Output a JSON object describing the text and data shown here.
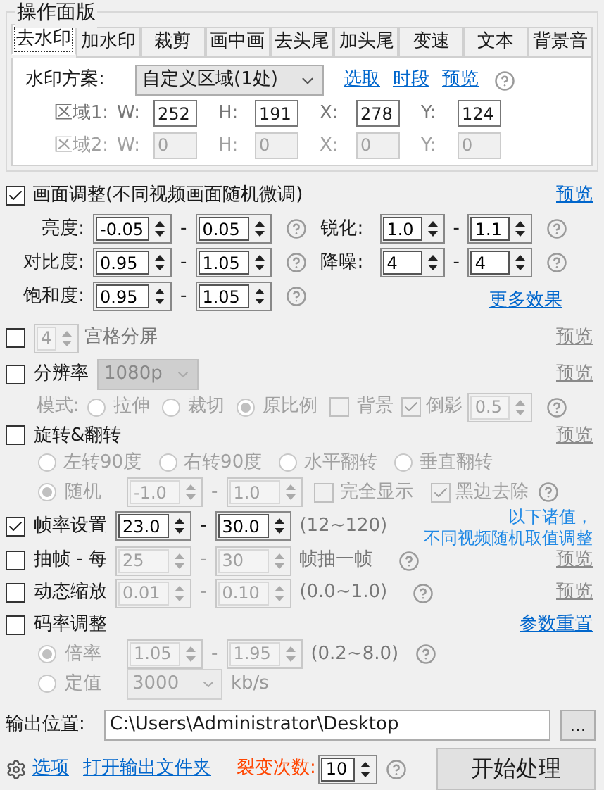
{
  "panel_title": "操作面版",
  "tabs": [
    {
      "label": "去水印",
      "selected": true
    },
    {
      "label": "加水印",
      "selected": false
    },
    {
      "label": "裁剪",
      "selected": false
    },
    {
      "label": "画中画",
      "selected": false
    },
    {
      "label": "去头尾",
      "selected": false
    },
    {
      "label": "加头尾",
      "selected": false
    },
    {
      "label": "变速",
      "selected": false
    },
    {
      "label": "文本",
      "selected": false
    },
    {
      "label": "背景音",
      "selected": false
    }
  ],
  "watermark": {
    "scheme_label": "水印方案:",
    "scheme_value": "自定义区域(1处)",
    "links": [
      "选取",
      "时段",
      "预览"
    ],
    "regions": [
      {
        "label": "区域1:",
        "disabled": false,
        "fields": [
          {
            "label": "W:",
            "value": "252"
          },
          {
            "label": "H:",
            "value": "191"
          },
          {
            "label": "X:",
            "value": "278"
          },
          {
            "label": "Y:",
            "value": "124"
          }
        ]
      },
      {
        "label": "区域2:",
        "disabled": true,
        "fields": [
          {
            "label": "W:",
            "value": "0"
          },
          {
            "label": "H:",
            "value": "0"
          },
          {
            "label": "X:",
            "value": "0"
          },
          {
            "label": "Y:",
            "value": "0"
          }
        ]
      }
    ]
  },
  "picture_adjust": {
    "label": "画面调整(不同视频画面随机微调)",
    "checked": true,
    "preview": "预览",
    "more": "更多效果",
    "left_params": [
      {
        "label": "亮度:",
        "min": "-0.05",
        "sep": "-",
        "max": "0.05"
      },
      {
        "label": "对比度:",
        "min": "0.95",
        "sep": "-",
        "max": "1.05"
      },
      {
        "label": "饱和度:",
        "min": "0.95",
        "sep": "-",
        "max": "1.05"
      }
    ],
    "right_params": [
      {
        "label": "锐化:",
        "min": "1.0",
        "sep": "-",
        "max": "1.1"
      },
      {
        "label": "降噪:",
        "min": "4",
        "sep": "-",
        "max": "4"
      }
    ]
  },
  "grid": {
    "checked": false,
    "value": "4",
    "label": "宫格分屏",
    "preview": "预览"
  },
  "resolution": {
    "checked": false,
    "label": "分辨率",
    "value": "1080p",
    "preview": "预览",
    "mode_label": "模式:",
    "modes": [
      {
        "label": "拉伸",
        "selected": false
      },
      {
        "label": "裁切",
        "selected": false
      },
      {
        "label": "原比例",
        "selected": true
      }
    ],
    "background": {
      "label": "背景",
      "checked": false
    },
    "reflection": {
      "label": "倒影",
      "checked": true,
      "value": "0.5"
    }
  },
  "rotate": {
    "checked": false,
    "label": "旋转&翻转",
    "preview": "预览",
    "options": [
      {
        "label": "左转90度",
        "selected": false
      },
      {
        "label": "右转90度",
        "selected": false
      },
      {
        "label": "水平翻转",
        "selected": false
      },
      {
        "label": "垂直翻转",
        "selected": false
      }
    ],
    "random": {
      "label": "随机",
      "selected": true,
      "min": "-1.0",
      "sep": "-",
      "max": "1.0",
      "full_display": {
        "label": "完全显示",
        "checked": false
      },
      "remove_black": {
        "label": "黑边去除",
        "checked": true
      }
    }
  },
  "note": [
    "以下诸值，",
    "不同视频随机取值调整"
  ],
  "rows": [
    {
      "label": "帧率设置",
      "checked": true,
      "min": "23.0",
      "sep": "-",
      "max": "30.0",
      "suffix": "(12~120)",
      "help": false,
      "preview": ""
    },
    {
      "label": "抽帧 - 每",
      "checked": false,
      "min": "25",
      "sep": "-",
      "max": "30",
      "suffix": "帧抽一帧",
      "help": true,
      "preview": "预览"
    },
    {
      "label": "动态缩放",
      "checked": false,
      "min": "0.01",
      "sep": "-",
      "max": "0.10",
      "suffix": "(0.0~1.0)",
      "help": true,
      "preview": "预览"
    }
  ],
  "bitrate": {
    "checked": false,
    "label": "码率调整",
    "reset": "参数重置",
    "options": [
      {
        "kind": "range",
        "label": "倍率",
        "selected": true,
        "min": "1.05",
        "sep": "-",
        "max": "1.95",
        "hint": "(0.2~8.0)"
      },
      {
        "kind": "select",
        "label": "定值",
        "selected": false,
        "value": "3000",
        "unit": "kb/s"
      }
    ]
  },
  "output": {
    "label": "输出位置:",
    "path": "C:\\Users\\Administrator\\Desktop",
    "browse": "..."
  },
  "footer": {
    "options": "选项",
    "open_folder": "打开输出文件夹",
    "count_label": "裂变次数:",
    "count": "10",
    "start": "开始处理"
  }
}
